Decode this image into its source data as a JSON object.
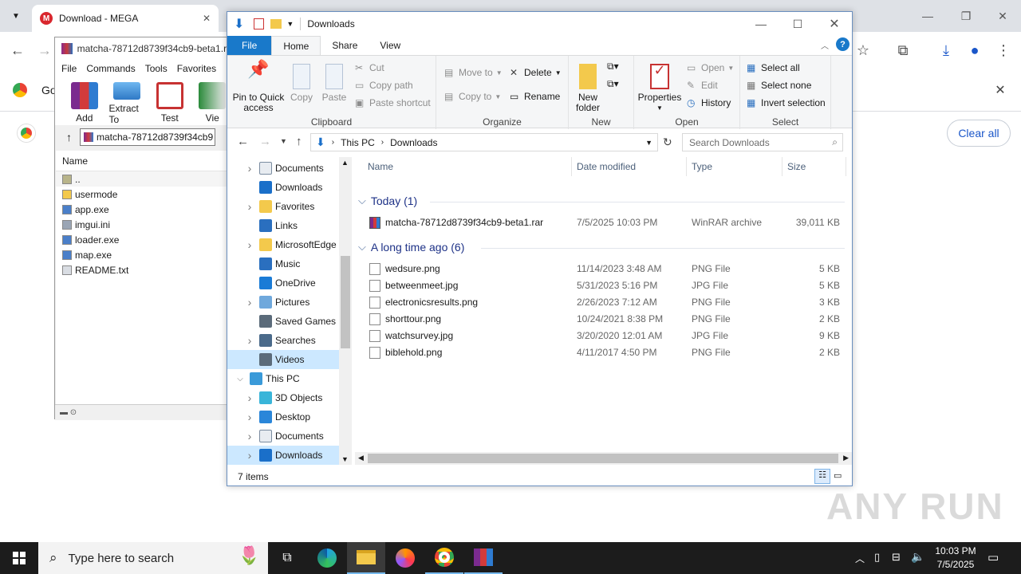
{
  "chrome": {
    "tab_title": "Download - MEGA",
    "shelf_partial_text": "Go",
    "clear_all": "Clear all"
  },
  "winrar": {
    "title": "matcha-78712d8739f34cb9-beta1.rar",
    "menu": [
      "File",
      "Commands",
      "Tools",
      "Favorites"
    ],
    "tools": [
      {
        "label": "Add",
        "icon": "archive-add-icon"
      },
      {
        "label": "Extract To",
        "icon": "extract-folder-icon"
      },
      {
        "label": "Test",
        "icon": "test-clipboard-icon"
      },
      {
        "label": "Vie",
        "icon": "view-book-icon"
      }
    ],
    "path": "matcha-78712d8739f34cb9",
    "column_name": "Name",
    "files": [
      {
        "name": "..",
        "icon": "parent-folder-icon"
      },
      {
        "name": "usermode",
        "icon": "folder-icon"
      },
      {
        "name": "app.exe",
        "icon": "exe-icon"
      },
      {
        "name": "imgui.ini",
        "icon": "ini-file-icon"
      },
      {
        "name": "loader.exe",
        "icon": "exe-icon"
      },
      {
        "name": "map.exe",
        "icon": "exe-icon"
      },
      {
        "name": "README.txt",
        "icon": "text-file-icon"
      }
    ]
  },
  "explorer": {
    "title": "Downloads",
    "tabs": [
      "File",
      "Home",
      "Share",
      "View"
    ],
    "ribbon": {
      "clipboard": {
        "label": "Clipboard",
        "pin": "Pin to Quick access",
        "copy": "Copy",
        "paste": "Paste",
        "cut": "Cut",
        "copy_path": "Copy path",
        "paste_shortcut": "Paste shortcut"
      },
      "organize": {
        "label": "Organize",
        "move_to": "Move to",
        "copy_to": "Copy to",
        "delete": "Delete",
        "rename": "Rename"
      },
      "new": {
        "label": "New",
        "new_folder": "New folder"
      },
      "open": {
        "label": "Open",
        "properties": "Properties",
        "open": "Open",
        "edit": "Edit",
        "history": "History"
      },
      "select": {
        "label": "Select",
        "select_all": "Select all",
        "select_none": "Select none",
        "invert": "Invert selection"
      }
    },
    "breadcrumb": [
      "This PC",
      "Downloads"
    ],
    "search_placeholder": "Search Downloads",
    "nav": [
      {
        "label": "Documents",
        "icon": "documents-icon",
        "expand": true,
        "indent": 0
      },
      {
        "label": "Downloads",
        "icon": "downloads-icon",
        "expand": false,
        "indent": 0
      },
      {
        "label": "Favorites",
        "icon": "favorites-icon",
        "expand": true,
        "indent": 0
      },
      {
        "label": "Links",
        "icon": "links-icon",
        "expand": false,
        "indent": 0
      },
      {
        "label": "MicrosoftEdge",
        "icon": "folder-icon",
        "expand": true,
        "indent": 0
      },
      {
        "label": "Music",
        "icon": "music-icon",
        "expand": false,
        "indent": 0
      },
      {
        "label": "OneDrive",
        "icon": "onedrive-icon",
        "expand": false,
        "indent": 0
      },
      {
        "label": "Pictures",
        "icon": "pictures-icon",
        "expand": true,
        "indent": 0
      },
      {
        "label": "Saved Games",
        "icon": "saved-games-icon",
        "expand": false,
        "indent": 0
      },
      {
        "label": "Searches",
        "icon": "searches-icon",
        "expand": true,
        "indent": 0
      },
      {
        "label": "Videos",
        "icon": "videos-icon",
        "expand": false,
        "indent": 0,
        "selected": true
      },
      {
        "label": "This PC",
        "icon": "this-pc-icon",
        "expand": "open",
        "indent": -1
      },
      {
        "label": "3D Objects",
        "icon": "3d-objects-icon",
        "expand": true,
        "indent": 0
      },
      {
        "label": "Desktop",
        "icon": "desktop-icon",
        "expand": true,
        "indent": 0
      },
      {
        "label": "Documents",
        "icon": "documents-icon",
        "expand": true,
        "indent": 0
      },
      {
        "label": "Downloads",
        "icon": "downloads-icon",
        "expand": true,
        "indent": 0,
        "selected": true
      }
    ],
    "columns": [
      "Name",
      "Date modified",
      "Type",
      "Size"
    ],
    "groups": [
      {
        "title": "Today (1)",
        "files": [
          {
            "name": "matcha-78712d8739f34cb9-beta1.rar",
            "date": "7/5/2025 10:03 PM",
            "type": "WinRAR archive",
            "size": "39,011 KB",
            "icon": "rar-archive-icon"
          }
        ]
      },
      {
        "title": "A long time ago (6)",
        "files": [
          {
            "name": "wedsure.png",
            "date": "11/14/2023 3:48 AM",
            "type": "PNG File",
            "size": "5 KB",
            "icon": "image-file-icon"
          },
          {
            "name": "betweenmeet.jpg",
            "date": "5/31/2023 5:16 PM",
            "type": "JPG File",
            "size": "5 KB",
            "icon": "image-file-icon"
          },
          {
            "name": "electronicsresults.png",
            "date": "2/26/2023 7:12 AM",
            "type": "PNG File",
            "size": "3 KB",
            "icon": "image-file-icon"
          },
          {
            "name": "shorttour.png",
            "date": "10/24/2021 8:38 PM",
            "type": "PNG File",
            "size": "2 KB",
            "icon": "image-file-icon"
          },
          {
            "name": "watchsurvey.jpg",
            "date": "3/20/2020 12:01 AM",
            "type": "JPG File",
            "size": "9 KB",
            "icon": "image-file-icon"
          },
          {
            "name": "biblehold.png",
            "date": "4/11/2017 4:50 PM",
            "type": "PNG File",
            "size": "2 KB",
            "icon": "image-file-icon"
          }
        ]
      }
    ],
    "status": "7 items"
  },
  "taskbar": {
    "search_placeholder": "Type here to search",
    "time": "10:03 PM",
    "date": "7/5/2025"
  },
  "watermark": "ANY RUN",
  "colors": {
    "accent": "#1979ca",
    "selection": "#cce8ff",
    "group_header": "#1e3287"
  }
}
